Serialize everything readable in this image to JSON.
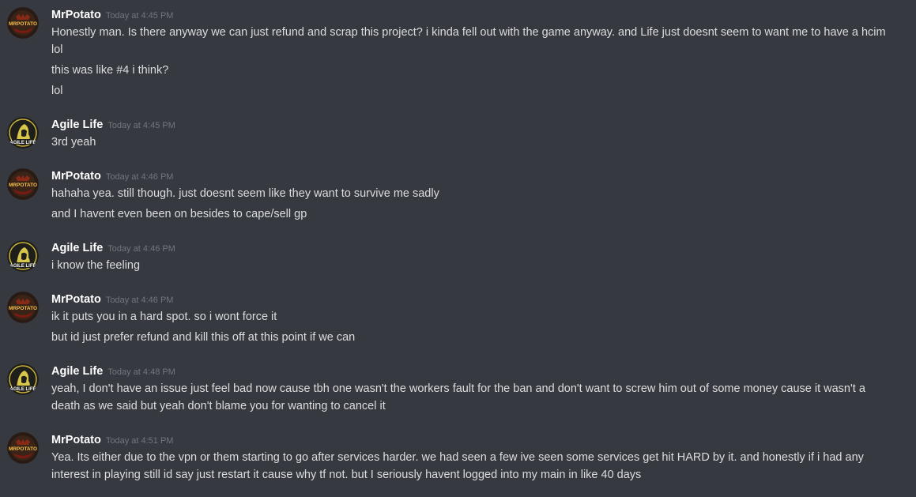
{
  "messages": [
    {
      "author": "MrPotato",
      "avatar": "mrpotato-avatar",
      "avatar_text": "MRPOTATO",
      "timestamp": "Today at 4:45 PM",
      "lines": [
        "Honestly man. Is there anyway we can just refund and scrap this project? i kinda fell out with the game anyway. and Life just doesnt seem to want me to have a hcim lol",
        "this was like #4 i think?",
        "lol"
      ]
    },
    {
      "author": "Agile Life",
      "avatar": "agile-life-avatar",
      "avatar_text": "AGILE LIFE",
      "timestamp": "Today at 4:45 PM",
      "lines": [
        "3rd yeah"
      ]
    },
    {
      "author": "MrPotato",
      "avatar": "mrpotato-avatar",
      "avatar_text": "MRPOTATO",
      "timestamp": "Today at 4:46 PM",
      "lines": [
        "hahaha yea. still though. just doesnt seem like they want to survive me sadly",
        "and I havent even been on besides to cape/sell gp"
      ]
    },
    {
      "author": "Agile Life",
      "avatar": "agile-life-avatar",
      "avatar_text": "AGILE LIFE",
      "timestamp": "Today at 4:46 PM",
      "lines": [
        "i know the feeling"
      ]
    },
    {
      "author": "MrPotato",
      "avatar": "mrpotato-avatar",
      "avatar_text": "MRPOTATO",
      "timestamp": "Today at 4:46 PM",
      "lines": [
        "ik it puts you in a hard spot. so i wont force it",
        "but id just prefer refund and kill this off at this point if we can"
      ]
    },
    {
      "author": "Agile Life",
      "avatar": "agile-life-avatar",
      "avatar_text": "AGILE LIFE",
      "timestamp": "Today at 4:48 PM",
      "lines": [
        "yeah, I don't have an issue just feel bad now cause tbh one wasn't the workers fault for the ban and don't want to screw him out of some money cause it wasn't a death as we said but yeah don't blame you for wanting to cancel it"
      ]
    },
    {
      "author": "MrPotato",
      "avatar": "mrpotato-avatar",
      "avatar_text": "MRPOTATO",
      "timestamp": "Today at 4:51 PM",
      "lines": [
        "Yea. Its either due to the vpn or them starting to go after services harder. we had seen a few ive seen some services get hit HARD by it. and honestly if i had any interest in playing still id say just restart it cause why tf not. but I seriously havent logged into my main in like 40 days"
      ]
    }
  ],
  "colors": {
    "background": "#36393f",
    "username": "#ffffff",
    "timestamp": "#72767d",
    "message_text": "#dcddde"
  }
}
